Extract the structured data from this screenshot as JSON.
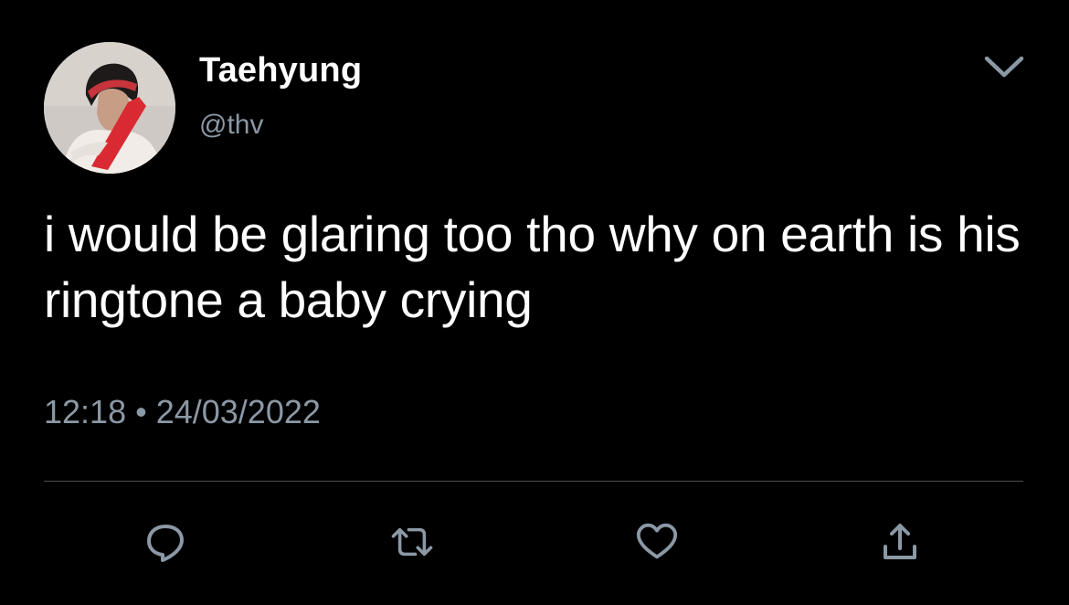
{
  "author": {
    "display_name": "Taehyung",
    "handle": "@thv",
    "avatar_icon": "profile-photo"
  },
  "tweet": {
    "text": "i would be glaring too tho why on earth is his ringtone a baby crying",
    "time": "12:18",
    "separator": "•",
    "date": "24/03/2022"
  },
  "actions": [
    {
      "icon": "reply-icon"
    },
    {
      "icon": "retweet-icon"
    },
    {
      "icon": "like-icon"
    },
    {
      "icon": "share-icon"
    }
  ],
  "colors": {
    "background": "#000000",
    "text": "#ffffff",
    "secondary_text": "#8b98a5",
    "icon": "#8b98a5",
    "divider": "#4a4e52"
  }
}
